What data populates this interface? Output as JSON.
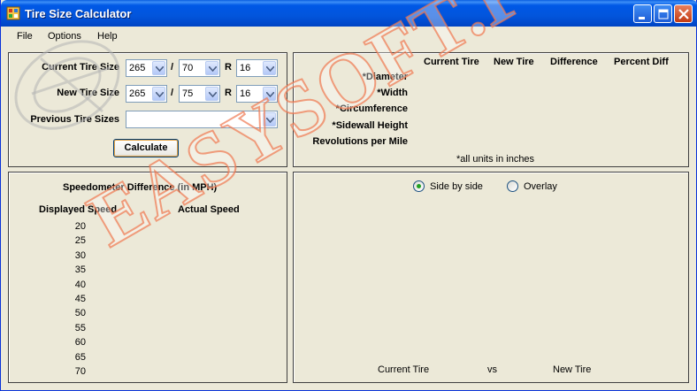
{
  "window": {
    "title": "Tire Size Calculator"
  },
  "menu": {
    "file": "File",
    "options": "Options",
    "help": "Help"
  },
  "input": {
    "current_label": "Current Tire Size",
    "new_label": "New Tire Size",
    "previous_label": "Previous Tire Sizes",
    "separator_slash": "/",
    "separator_r": "R",
    "current": {
      "width": "265",
      "ratio": "70",
      "rim": "16"
    },
    "new": {
      "width": "265",
      "ratio": "75",
      "rim": "16"
    },
    "previous": "",
    "calculate_label": "Calculate"
  },
  "results": {
    "headers": [
      "Current Tire",
      "New Tire",
      "Difference",
      "Percent Diff"
    ],
    "rows": [
      "*Diameter",
      "*Width",
      "*Circumference",
      "*Sidewall Height",
      "Revolutions per Mile"
    ],
    "note": "*all units in inches"
  },
  "speedo": {
    "title": "Speedometer Difference (in MPH)",
    "col_displayed": "Displayed Speed",
    "col_actual": "Actual Speed",
    "speeds": [
      "20",
      "25",
      "30",
      "35",
      "40",
      "45",
      "50",
      "55",
      "60",
      "65",
      "70"
    ]
  },
  "visual": {
    "side_by_side_label": "Side by side",
    "overlay_label": "Overlay",
    "selected": "side_by_side",
    "current_tire_label": "Current Tire",
    "vs_label": "vs",
    "new_tire_label": "New Tire"
  },
  "watermark": {
    "text": "EASYSOFT.PW"
  },
  "colors": {
    "titlebar": "#0055E5",
    "watermark_stroke": "#F07850",
    "radio_dot": "#21A121"
  }
}
